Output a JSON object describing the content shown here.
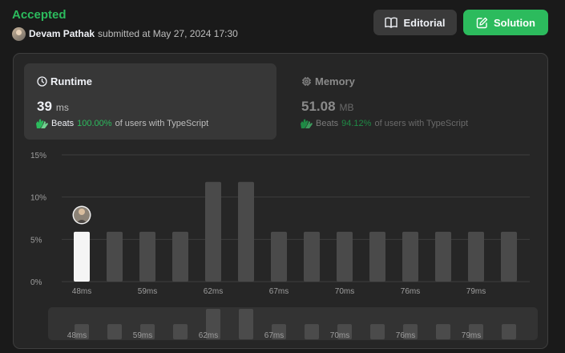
{
  "header": {
    "status": "Accepted",
    "submitter_name": "Devam Pathak",
    "submitted_text": "submitted at May 27, 2024 17:30",
    "editorial_label": "Editorial",
    "solution_label": "Solution",
    "accent_color": "#2cbb5d"
  },
  "runtime": {
    "title": "Runtime",
    "value": "39",
    "unit": "ms",
    "beats_label": "Beats",
    "beats_percent": "100.00%",
    "beats_rest": "of users with TypeScript"
  },
  "memory": {
    "title": "Memory",
    "value": "51.08",
    "unit": "MB",
    "beats_label": "Beats",
    "beats_percent": "94.12%",
    "beats_rest": "of users with TypeScript"
  },
  "icons": {
    "runtime": "clock-icon",
    "memory": "chip-icon",
    "editorial": "book-icon",
    "solution": "edit-icon",
    "beats": "clapping-hands-icon"
  },
  "chart_data": {
    "type": "bar",
    "ylabel": "",
    "xlabel": "",
    "y_ticks": [
      "15%",
      "10%",
      "5%",
      "0%"
    ],
    "ylim": [
      0,
      15
    ],
    "x_tick_labels": [
      "48ms",
      "59ms",
      "62ms",
      "67ms",
      "70ms",
      "76ms",
      "79ms"
    ],
    "bar_values": [
      5.9,
      5.9,
      5.9,
      5.9,
      11.8,
      11.8,
      5.9,
      5.9,
      5.9,
      5.9,
      5.9,
      5.9,
      5.9,
      5.9
    ],
    "highlighted_bar": 0,
    "grid": true
  }
}
